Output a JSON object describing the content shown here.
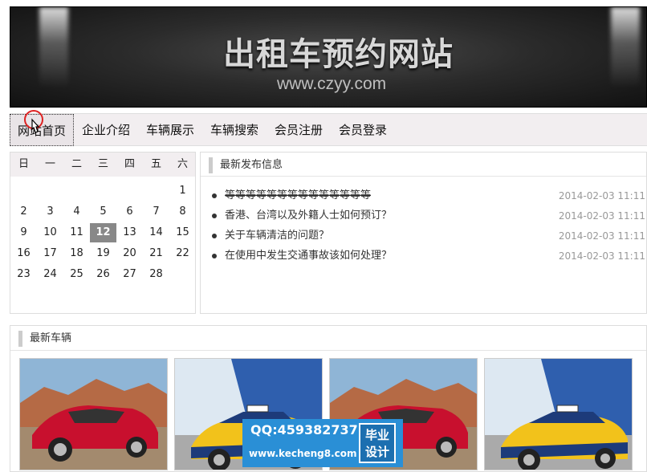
{
  "banner": {
    "title": "出租车预约网站",
    "url": "www.czyy.com"
  },
  "nav": {
    "items": [
      "网站首页",
      "企业介绍",
      "车辆展示",
      "车辆搜索",
      "会员注册",
      "会员登录"
    ]
  },
  "calendar": {
    "weekdays": [
      "日",
      "一",
      "二",
      "三",
      "四",
      "五",
      "六"
    ],
    "first_weekday_index": 6,
    "days_in_month": 28,
    "today": 12
  },
  "news": {
    "title": "最新发布信息",
    "items": [
      {
        "text": "等等等等等等等等等等等等等等",
        "date": "2014-02-03 11:11",
        "strikethrough": true
      },
      {
        "text": "香港、台湾以及外籍人士如何预订？",
        "date": "2014-02-03 11:11",
        "strikethrough": false
      },
      {
        "text": "关于车辆清洁的问题？",
        "date": "2014-02-03 11:11",
        "strikethrough": false
      },
      {
        "text": "在使用中发生交通事故该如何处理？",
        "date": "2014-02-03 11:11",
        "strikethrough": false
      }
    ]
  },
  "latest": {
    "title": "最新车辆",
    "cars": [
      {
        "kind": "red-sedan"
      },
      {
        "kind": "taxi-yellow-blue"
      },
      {
        "kind": "red-sedan"
      },
      {
        "kind": "taxi-yellow-blue"
      }
    ]
  },
  "watermark": {
    "qq": "QQ:459382737",
    "site": "www.kecheng8.com",
    "badge": [
      "毕业",
      "设计"
    ]
  },
  "icons": {
    "cursor": "hand-pointer-icon",
    "bullet": "bullet-icon"
  },
  "colors": {
    "nav_bg": "#f2eef0",
    "today_bg": "#888888",
    "watermark_bg": "#2a8fd6"
  }
}
